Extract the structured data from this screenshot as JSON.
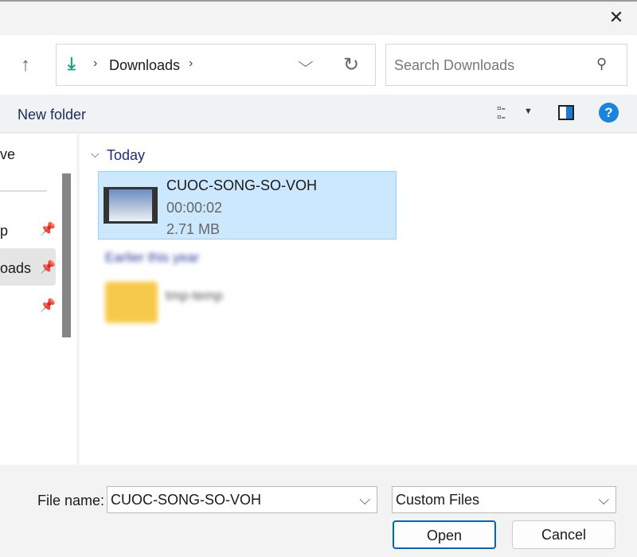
{
  "nav": {
    "location": "Downloads",
    "search_placeholder": "Search Downloads"
  },
  "command_bar": {
    "new_folder": "New folder"
  },
  "sidebar": {
    "items": [
      {
        "label": "ve"
      },
      {
        "label": "p"
      },
      {
        "label": "oads"
      }
    ]
  },
  "main": {
    "groups": [
      {
        "label": "Today",
        "files": [
          {
            "name": "CUOC-SONG-SO-VOH",
            "duration": "00:00:02",
            "size": "2.71 MB",
            "selected": true
          }
        ]
      },
      {
        "label": "Earlier this year",
        "files": [
          {
            "name": "tmp-temp"
          }
        ]
      }
    ]
  },
  "footer": {
    "file_name_label": "File name:",
    "file_name_value": "CUOC-SONG-SO-VOH",
    "file_type": "Custom Files",
    "open": "Open",
    "cancel": "Cancel"
  },
  "colors": {
    "accent": "#0067c0",
    "selection": "#cce8ff",
    "selection_border": "#99d1ff",
    "download_green": "#14a37f"
  }
}
